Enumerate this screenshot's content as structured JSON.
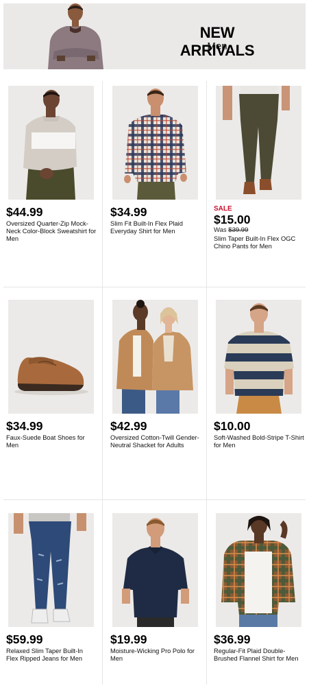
{
  "banner": {
    "title": "NEW ARRIVALS",
    "subtitle": "Men"
  },
  "products": [
    {
      "price": "$44.99",
      "name": "Oversized Quarter-Zip Mock-Neck Color-Block Sweatshirt for Men"
    },
    {
      "price": "$34.99",
      "name": "Slim Fit Built-In Flex Plaid Everyday Shirt for Men"
    },
    {
      "sale": "SALE",
      "price": "$15.00",
      "was_label": "Was",
      "was_price": "$39.99",
      "name": "Slim Taper Built-In Flex OGC Chino Pants for Men"
    },
    {
      "price": "$34.99",
      "name": "Faux-Suede Boat Shoes for Men"
    },
    {
      "price": "$42.99",
      "name": "Oversized Cotton-Twill Gender-Neutral Shacket for Adults"
    },
    {
      "price": "$10.00",
      "name": "Soft-Washed Bold-Stripe T-Shirt for Men"
    },
    {
      "price": "$59.99",
      "name": "Relaxed Slim Taper Built-In Flex Ripped Jeans for Men"
    },
    {
      "price": "$19.99",
      "name": "Moisture-Wicking Pro Polo for Men"
    },
    {
      "price": "$36.99",
      "name": "Regular-Fit Plaid Double-Brushed Flannel Shirt for Men"
    }
  ],
  "colors": {
    "sale": "#c8102e",
    "banner_bg": "#ebe9e7",
    "image_bg": "#eceae8"
  }
}
